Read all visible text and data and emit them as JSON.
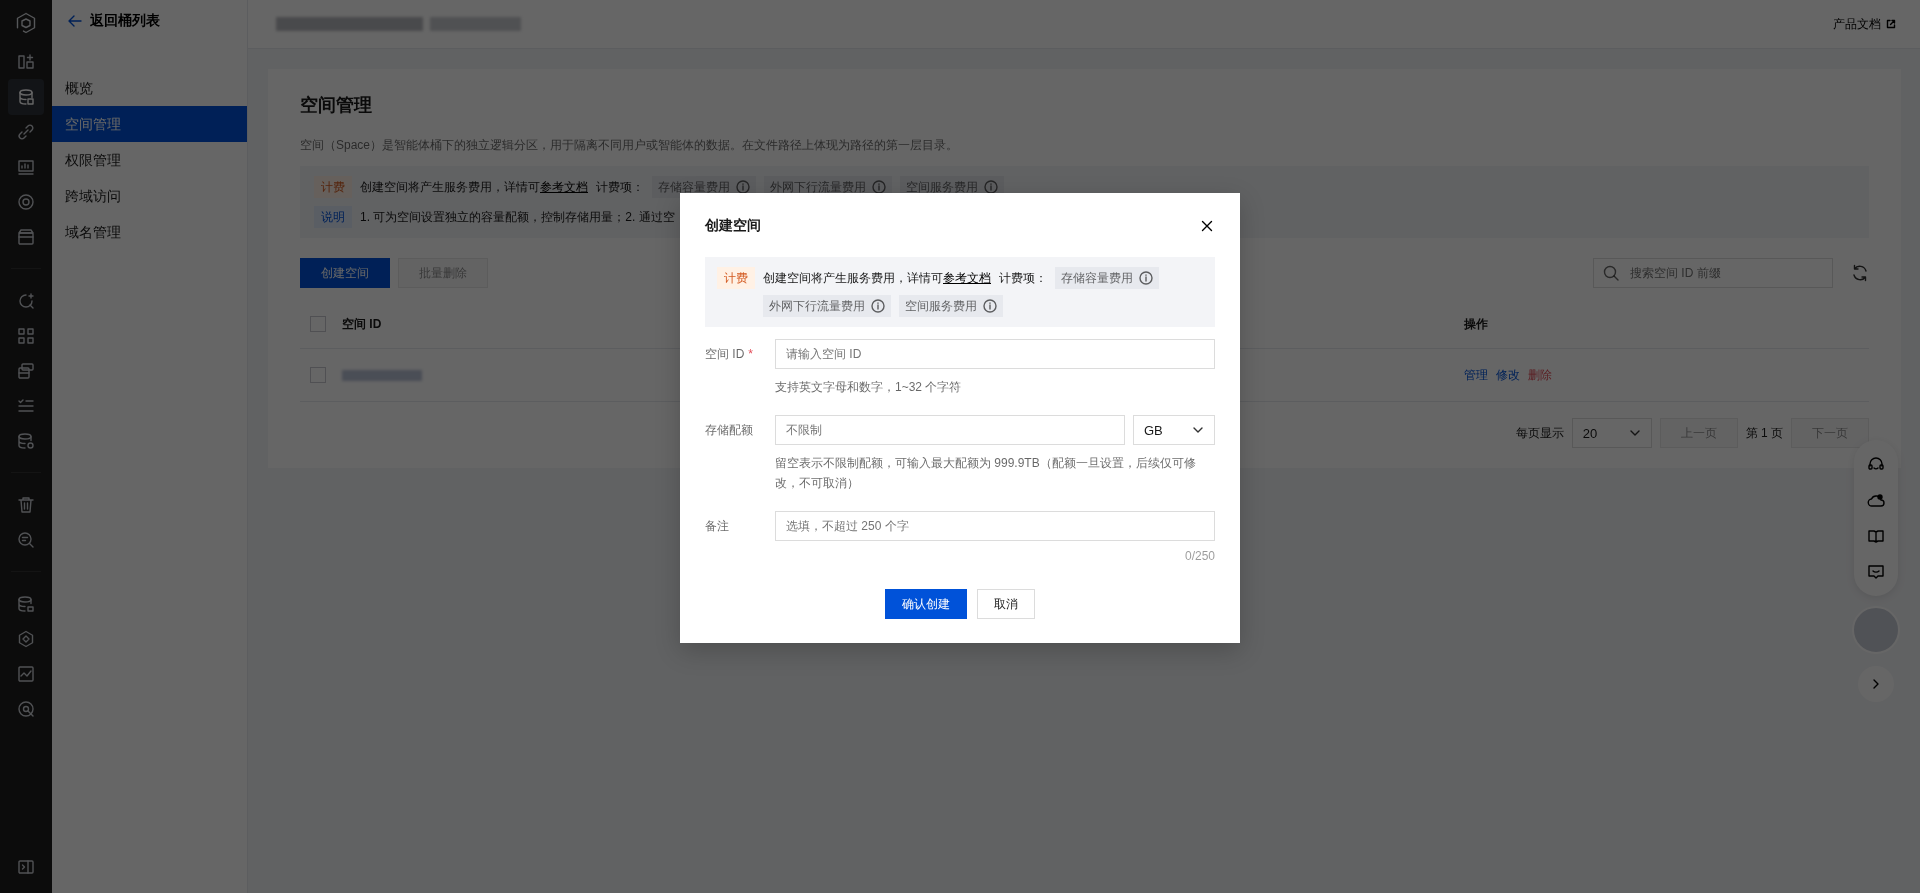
{
  "rail": {
    "groups": [
      [
        {
          "selected": false
        },
        {
          "selected": true
        },
        {
          "selected": false
        },
        {
          "selected": false
        },
        {
          "selected": false
        },
        {
          "selected": false
        }
      ],
      [
        {
          "selected": false
        },
        {
          "selected": false
        },
        {
          "selected": false
        },
        {
          "selected": false
        },
        {
          "selected": false
        }
      ],
      [
        {
          "selected": false
        },
        {
          "selected": false
        }
      ],
      [
        {
          "selected": false
        },
        {
          "selected": false
        },
        {
          "selected": false
        },
        {
          "selected": false
        }
      ]
    ]
  },
  "nav": {
    "back": "返回桶列表",
    "items": [
      {
        "label": "概览",
        "selected": false
      },
      {
        "label": "空间管理",
        "selected": true
      },
      {
        "label": "权限管理",
        "selected": false
      },
      {
        "label": "跨域访问",
        "selected": false
      },
      {
        "label": "域名管理",
        "selected": false
      }
    ]
  },
  "header": {
    "doc_link": "产品文档"
  },
  "page": {
    "title": "空间管理",
    "description": "空间（Space）是智能体桶下的独立逻辑分区，用于隔离不同用户或智能体的数据。在文件路径上体现为路径的第一层目录。",
    "notices": [
      {
        "kind": "billing",
        "tag": "计费",
        "text": "创建空间将产生服务费用，详情可",
        "link": "参考文档",
        "items_label": "计费项：",
        "items": [
          "存储容量费用",
          "外网下行流量费用",
          "空间服务费用"
        ]
      },
      {
        "kind": "info",
        "tag": "说明",
        "text": "1. 可为空间设置独立的容量配额，控制存储用量；2. 通过空"
      }
    ],
    "toolbar": {
      "create": "创建空间",
      "batch_delete": {
        "label": "批量删除",
        "disabled": true
      },
      "search_placeholder": "搜索空间 ID 前缀"
    },
    "table": {
      "select_all_checked": false,
      "columns": [
        "空间 ID",
        "操作"
      ],
      "rows": [
        {
          "checked": false,
          "actions": [
            {
              "label": "管理",
              "kind": "normal"
            },
            {
              "label": "修改",
              "kind": "normal"
            },
            {
              "label": "删除",
              "kind": "danger"
            }
          ]
        }
      ]
    },
    "pagination": {
      "page_size_label": "每页显示",
      "page_size": "20",
      "prev": {
        "label": "上一页",
        "disabled": true
      },
      "page": "第 1 页",
      "next": {
        "label": "下一页",
        "disabled": true
      }
    }
  },
  "dialog": {
    "title": "创建空间",
    "notice": {
      "tag": "计费",
      "text": "创建空间将产生服务费用，详情可",
      "link": "参考文档",
      "items_label": "计费项：",
      "items": [
        "存储容量费用",
        "外网下行流量费用",
        "空间服务费用"
      ]
    },
    "fields": [
      {
        "kind": "text",
        "label": "空间 ID",
        "required_mark": "*",
        "placeholder": "请输入空间 ID",
        "help": "支持英文字母和数字，1~32 个字符"
      },
      {
        "kind": "quota",
        "label": "存储配额",
        "placeholder": "不限制",
        "unit": "GB",
        "help": "留空表示不限制配额，可输入最大配额为 999.9TB（配额一旦设置，后续仅可修改，不可取消）"
      },
      {
        "kind": "text",
        "label": "备注",
        "placeholder": "选填，不超过 250 个字",
        "counter": "0/250"
      }
    ],
    "confirm": "确认创建",
    "cancel": "取消"
  }
}
